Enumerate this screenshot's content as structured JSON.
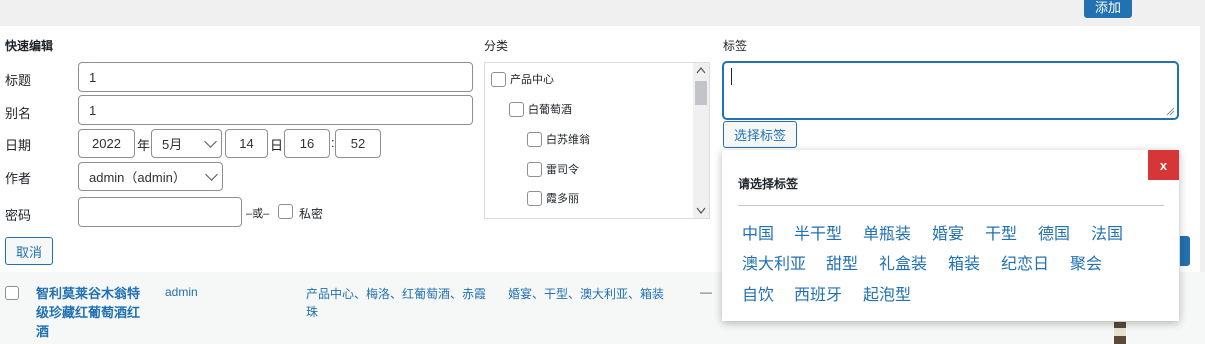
{
  "header": {
    "add_button": "添加"
  },
  "quick_edit": {
    "heading": "快速编辑",
    "title_label": "标题",
    "title_value": "1",
    "slug_label": "别名",
    "slug_value": "1",
    "date_label": "日期",
    "year": "2022",
    "year_unit": "年",
    "month": "5月",
    "day": "14",
    "day_unit": "日",
    "hour": "16",
    "time_sep": ":",
    "minute": "52",
    "author_label": "作者",
    "author_value": "admin（admin）",
    "password_label": "密码",
    "password_value": "",
    "or_text": "–或–",
    "private_label": "私密",
    "cancel_button": "取消"
  },
  "category": {
    "heading": "分类",
    "items": [
      {
        "label": "产品中心",
        "checked": false
      },
      {
        "label": "白葡萄酒",
        "checked": false
      },
      {
        "label": "白苏维翁",
        "checked": false
      },
      {
        "label": "雷司令",
        "checked": false
      },
      {
        "label": "霞多丽",
        "checked": false
      }
    ]
  },
  "tags": {
    "heading": "标签",
    "textarea_value": "",
    "choose_button": "选择标签",
    "popup": {
      "title": "请选择标签",
      "close_label": "x",
      "items": [
        "中国",
        "半干型",
        "单瓶装",
        "婚宴",
        "干型",
        "德国",
        "法国",
        "澳大利亚",
        "甜型",
        "礼盒装",
        "箱装",
        "纪恋日",
        "聚会",
        "自饮",
        "西班牙",
        "起泡型"
      ]
    }
  },
  "list_row": {
    "title": "智利莫莱谷木翁特级珍藏红葡萄酒红酒",
    "author": "admin",
    "categories": "产品中心、梅洛、红葡萄酒、赤霞珠",
    "tags": "婚宴、干型、澳大利亚、箱装",
    "dash": "—"
  },
  "colors": {
    "accent": "#2271b1",
    "close_red": "#d63638"
  }
}
